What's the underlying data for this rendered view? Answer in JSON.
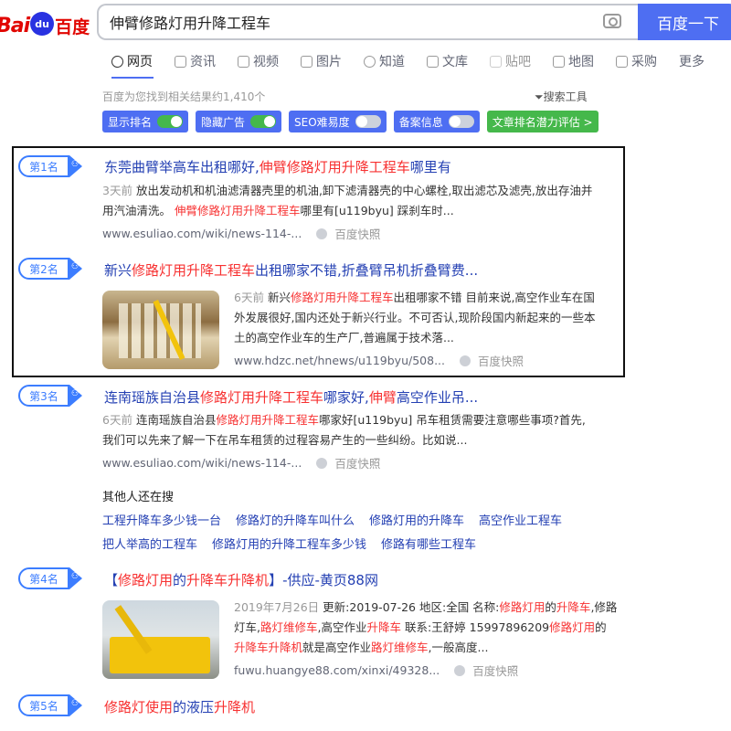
{
  "header": {
    "logo_bai": "Bai",
    "logo_du": "du",
    "logo_cn": "百度",
    "query": "伸臂修路灯用升降工程车",
    "search_button": "百度一下"
  },
  "tabs": [
    {
      "label": "网页"
    },
    {
      "label": "资讯"
    },
    {
      "label": "视频"
    },
    {
      "label": "图片"
    },
    {
      "label": "知道"
    },
    {
      "label": "文库"
    },
    {
      "label": "贴吧"
    },
    {
      "label": "地图"
    },
    {
      "label": "采购"
    },
    {
      "label": "更多"
    }
  ],
  "result_count": "百度为您找到相关结果约1,410个",
  "search_tools": "搜索工具",
  "toggles": [
    {
      "label": "显示排名",
      "on": true
    },
    {
      "label": "隐藏广告",
      "on": true
    },
    {
      "label": "SEO难易度",
      "on": false
    },
    {
      "label": "备案信息",
      "on": false
    }
  ],
  "toggle_extra": "文章排名潜力评估 >",
  "results": [
    {
      "rank": "第1名",
      "title_pre": "东莞曲臂举高车出租哪好,",
      "title_hl": "伸臂修路灯用升降工程车",
      "title_post": "哪里有",
      "time": "3天前",
      "abs1": "放出发动机和机油滤清器壳里的机油,卸下滤清器壳的中心螺栓,取出滤芯及滤壳,放出存油并",
      "abs2_pre": "用汽油清洗。 ",
      "abs2_hl": "伸臂修路灯用升降工程车",
      "abs2_post": "哪里有[u119byu] 踩刹车时...",
      "url": "www.esuliao.com/wiki/news-114-...",
      "snap": "百度快照"
    },
    {
      "rank": "第2名",
      "title_pre": "新兴",
      "title_hl": "修路灯用升降工程车",
      "title_post": "出租哪家不错,折叠臂吊机折叠臂费...",
      "time": "6天前",
      "abs1_pre": "新兴",
      "abs1_hl": "修路灯用升降工程车",
      "abs1_post": "出租哪家不错 目前来说,高空作业车在国",
      "abs2": "外发展很好,国内还处于新兴行业。不可否认,现阶段国内新起来的一些本",
      "abs3": "土的高空作业车的生产厂,普遍属于技术落...",
      "url": "www.hdzc.net/hnews/u119byu/508...",
      "snap": "百度快照"
    },
    {
      "rank": "第3名",
      "title_pre": "连南瑶族自治县",
      "title_hl": "修路灯用升降工程车",
      "title_mid": "哪家好,",
      "title_hl2": "伸臂",
      "title_post": "高空作业吊...",
      "time": "6天前",
      "abs1_pre": "连南瑶族自治县",
      "abs1_hl": "修路灯用升降工程车",
      "abs1_post": "哪家好[u119byu] 吊车租赁需要注意哪些事项?首先,",
      "abs2": "我们可以先来了解一下在吊车租赁的过程容易产生的一些纠纷。比如说...",
      "url": "www.esuliao.com/wiki/news-114-...",
      "snap": "百度快照"
    },
    {
      "rank": "第4名",
      "title_pre": "【",
      "title_hl": "修路灯用",
      "title_mid": "的",
      "title_hl2": "升降车升降机",
      "title_post": "】-供应-黄页88网",
      "time": "2019年7月26日",
      "l1_a": "更新:2019-07-26 地区:全国 名称:",
      "l1_b": "修路灯用",
      "l1_c": "的",
      "l1_d": "升降车",
      "l1_e": ",修路",
      "l2_a": "灯车,",
      "l2_b": "路灯维修车",
      "l2_c": ",高空作业",
      "l2_d": "升降车",
      "l2_e": " 联系:王舒婷 15997896209",
      "l2_f": "修路灯用",
      "l2_g": "的",
      "l3_a": "升降车升降机",
      "l3_b": "就是高空作业",
      "l3_c": "路灯维修车",
      "l3_d": ",一般高度...",
      "url": "fuwu.huangye88.com/xinxi/49328...",
      "snap": "百度快照"
    },
    {
      "rank": "第5名",
      "title_hl": "修路灯使用",
      "title_mid": "的液压",
      "title_hl2": "升降机"
    }
  ],
  "others": {
    "title": "其他人还在搜",
    "row1": [
      "工程升降车多少钱一台",
      "修路灯的升降车叫什么",
      "修路灯用的升降车",
      "高空作业工程车"
    ],
    "row2": [
      "把人举高的工程车",
      "修路灯用的升降工程车多少钱",
      "修路有哪些工程车"
    ]
  }
}
